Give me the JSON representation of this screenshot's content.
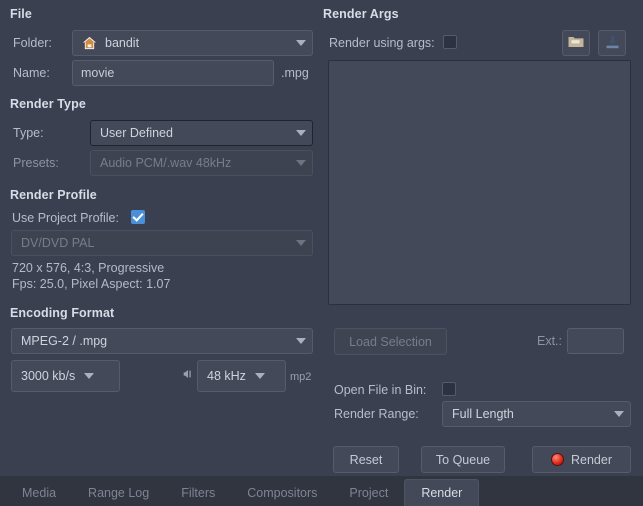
{
  "window": {
    "title": "Render"
  },
  "file": {
    "section_label": "File",
    "folder_label": "Folder:",
    "folder_value": "bandit",
    "folder_icon": "home-icon",
    "name_label": "Name:",
    "name_value": "movie",
    "extension_suffix": ".mpg"
  },
  "render_type": {
    "section_label": "Render Type",
    "type_label": "Type:",
    "type_value": "User Defined",
    "presets_label": "Presets:",
    "presets_value": "Audio PCM/.wav 48kHz"
  },
  "render_profile": {
    "section_label": "Render Profile",
    "use_project_profile_label": "Use Project Profile:",
    "use_project_profile_checked": true,
    "profile_value": "DV/DVD PAL",
    "info_line1": "720 x 576, 4:3, Progressive",
    "info_line2": "Fps: 25.0, Pixel Aspect: 1.07"
  },
  "encoding_format": {
    "section_label": "Encoding Format",
    "format_value": "MPEG-2 / .mpg",
    "bitrate_value": "3000 kb/s",
    "audio_icon": "speaker-icon",
    "samplerate_value": "48 kHz",
    "audio_codec": "mp2"
  },
  "render_args": {
    "section_label": "Render Args",
    "use_args_label": "Render using args:",
    "use_args_checked": false,
    "open_icon": "folder-open-icon",
    "save_icon": "save-download-icon",
    "args_text": "",
    "load_selection_label": "Load Selection",
    "ext_label": "Ext.:",
    "ext_value": ""
  },
  "output_options": {
    "open_file_in_bin_label": "Open File in Bin:",
    "open_file_in_bin_checked": false,
    "render_range_label": "Render Range:",
    "render_range_value": "Full Length"
  },
  "actions": {
    "reset_label": "Reset",
    "to_queue_label": "To Queue",
    "render_label": "Render",
    "render_icon": "record-dot-icon"
  },
  "tabs": [
    {
      "label": "Media",
      "active": false
    },
    {
      "label": "Range Log",
      "active": false
    },
    {
      "label": "Filters",
      "active": false
    },
    {
      "label": "Compositors",
      "active": false
    },
    {
      "label": "Project",
      "active": false
    },
    {
      "label": "Render",
      "active": true
    }
  ],
  "colors": {
    "background": "#3b4050",
    "widget": "#434958",
    "border": "#565c6c",
    "text": "#c9ced9",
    "text_dim": "#8d93a2",
    "accent_checkbox": "#4a90d9",
    "record_red": "#e02d20",
    "tabbar_background": "#31353f"
  }
}
